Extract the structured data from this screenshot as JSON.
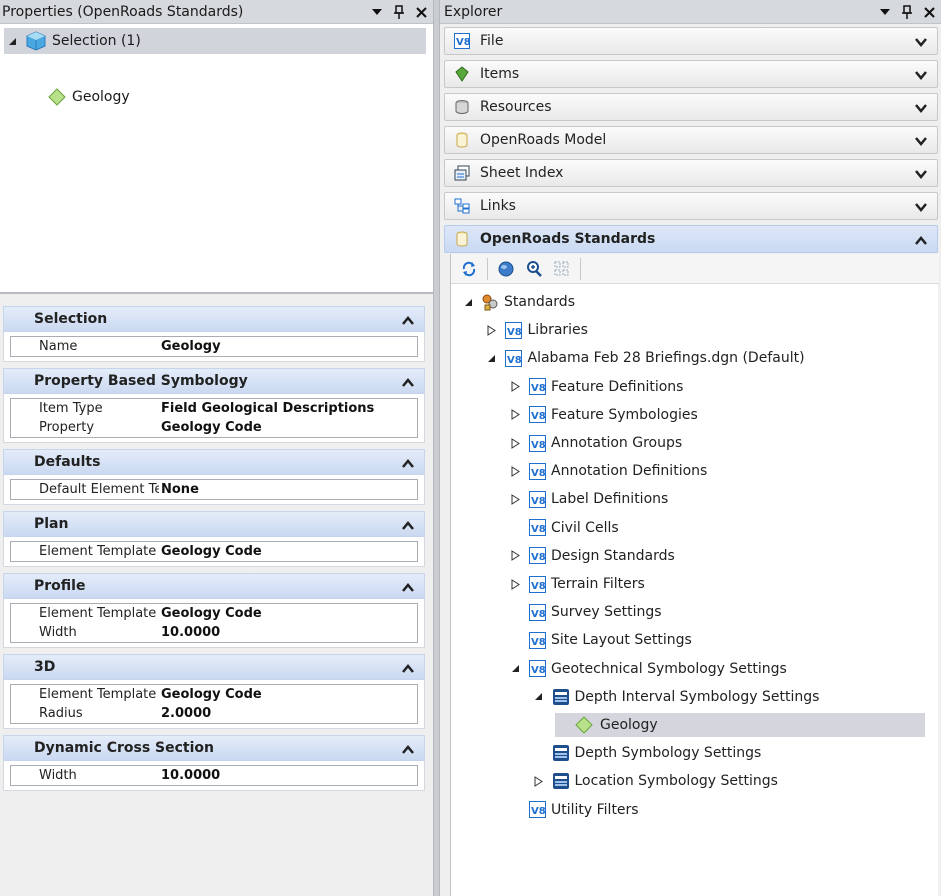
{
  "properties_panel": {
    "title": "Properties (OpenRoads Standards)",
    "selection_root": "Selection (1)",
    "selection_child": "Geology",
    "sections": [
      {
        "title": "Selection",
        "rows": [
          {
            "name": "Name",
            "value": "Geology"
          }
        ]
      },
      {
        "title": "Property Based Symbology",
        "rows": [
          {
            "name": "Item Type",
            "value": "Field Geological Descriptions"
          },
          {
            "name": "Property",
            "value": "Geology Code"
          }
        ]
      },
      {
        "title": "Defaults",
        "rows": [
          {
            "name": "Default Element Templat",
            "value": "None"
          }
        ]
      },
      {
        "title": "Plan",
        "rows": [
          {
            "name": "Element Template Group",
            "value": "Geology Code"
          }
        ]
      },
      {
        "title": "Profile",
        "rows": [
          {
            "name": "Element Template Group",
            "value": "Geology Code"
          },
          {
            "name": "Width",
            "value": "10.0000"
          }
        ]
      },
      {
        "title": "3D",
        "rows": [
          {
            "name": "Element Template Group",
            "value": "Geology Code"
          },
          {
            "name": "Radius",
            "value": "2.0000"
          }
        ]
      },
      {
        "title": "Dynamic Cross Section",
        "rows": [
          {
            "name": "Width",
            "value": "10.0000"
          }
        ]
      }
    ]
  },
  "explorer": {
    "title": "Explorer",
    "items": [
      {
        "label": "File",
        "icon": "v8-file-icon"
      },
      {
        "label": "Items",
        "icon": "items-icon"
      },
      {
        "label": "Resources",
        "icon": "resources-icon"
      },
      {
        "label": "OpenRoads Model",
        "icon": "openroads-model-icon"
      },
      {
        "label": "Sheet Index",
        "icon": "sheet-index-icon"
      },
      {
        "label": "Links",
        "icon": "links-icon"
      },
      {
        "label": "OpenRoads Standards",
        "icon": "openroads-standards-icon"
      }
    ],
    "tree": [
      {
        "label": "Standards",
        "level": 0,
        "expander": "expanded",
        "icon": "standards-icon"
      },
      {
        "label": "Libraries",
        "level": 1,
        "expander": "collapsed",
        "icon": "v8-icon"
      },
      {
        "label": "Alabama Feb 28 Briefings.dgn (Default)",
        "level": 1,
        "expander": "expanded",
        "icon": "v8-icon"
      },
      {
        "label": "Feature Definitions",
        "level": 2,
        "expander": "collapsed",
        "icon": "v8-icon"
      },
      {
        "label": "Feature Symbologies",
        "level": 2,
        "expander": "collapsed",
        "icon": "v8-icon"
      },
      {
        "label": "Annotation Groups",
        "level": 2,
        "expander": "collapsed",
        "icon": "v8-icon"
      },
      {
        "label": "Annotation Definitions",
        "level": 2,
        "expander": "collapsed",
        "icon": "v8-icon"
      },
      {
        "label": "Label Definitions",
        "level": 2,
        "expander": "collapsed",
        "icon": "v8-icon"
      },
      {
        "label": "Civil Cells",
        "level": 2,
        "expander": "none",
        "icon": "v8-icon"
      },
      {
        "label": "Design Standards",
        "level": 2,
        "expander": "collapsed",
        "icon": "v8-icon"
      },
      {
        "label": "Terrain Filters",
        "level": 2,
        "expander": "collapsed",
        "icon": "v8-icon"
      },
      {
        "label": "Survey Settings",
        "level": 2,
        "expander": "none",
        "icon": "v8-icon"
      },
      {
        "label": "Site Layout Settings",
        "level": 2,
        "expander": "none",
        "icon": "v8-icon"
      },
      {
        "label": "Geotechnical Symbology Settings",
        "level": 2,
        "expander": "expanded",
        "icon": "v8-icon"
      },
      {
        "label": "Depth Interval Symbology Settings",
        "level": 3,
        "expander": "expanded",
        "icon": "symbology-settings-icon"
      },
      {
        "label": "Geology",
        "level": 4,
        "expander": "none",
        "icon": "geology-diamond-icon",
        "selected": true
      },
      {
        "label": "Depth Symbology Settings",
        "level": 3,
        "expander": "none",
        "icon": "symbology-settings-icon"
      },
      {
        "label": "Location Symbology Settings",
        "level": 3,
        "expander": "collapsed",
        "icon": "symbology-settings-icon"
      },
      {
        "label": "Utility Filters",
        "level": 2,
        "expander": "none",
        "icon": "v8-icon"
      }
    ]
  },
  "colors": {
    "selection_bg": "#d4d5dd",
    "section_header": "#cad9f1",
    "accent_blue": "#1f6fd1"
  }
}
